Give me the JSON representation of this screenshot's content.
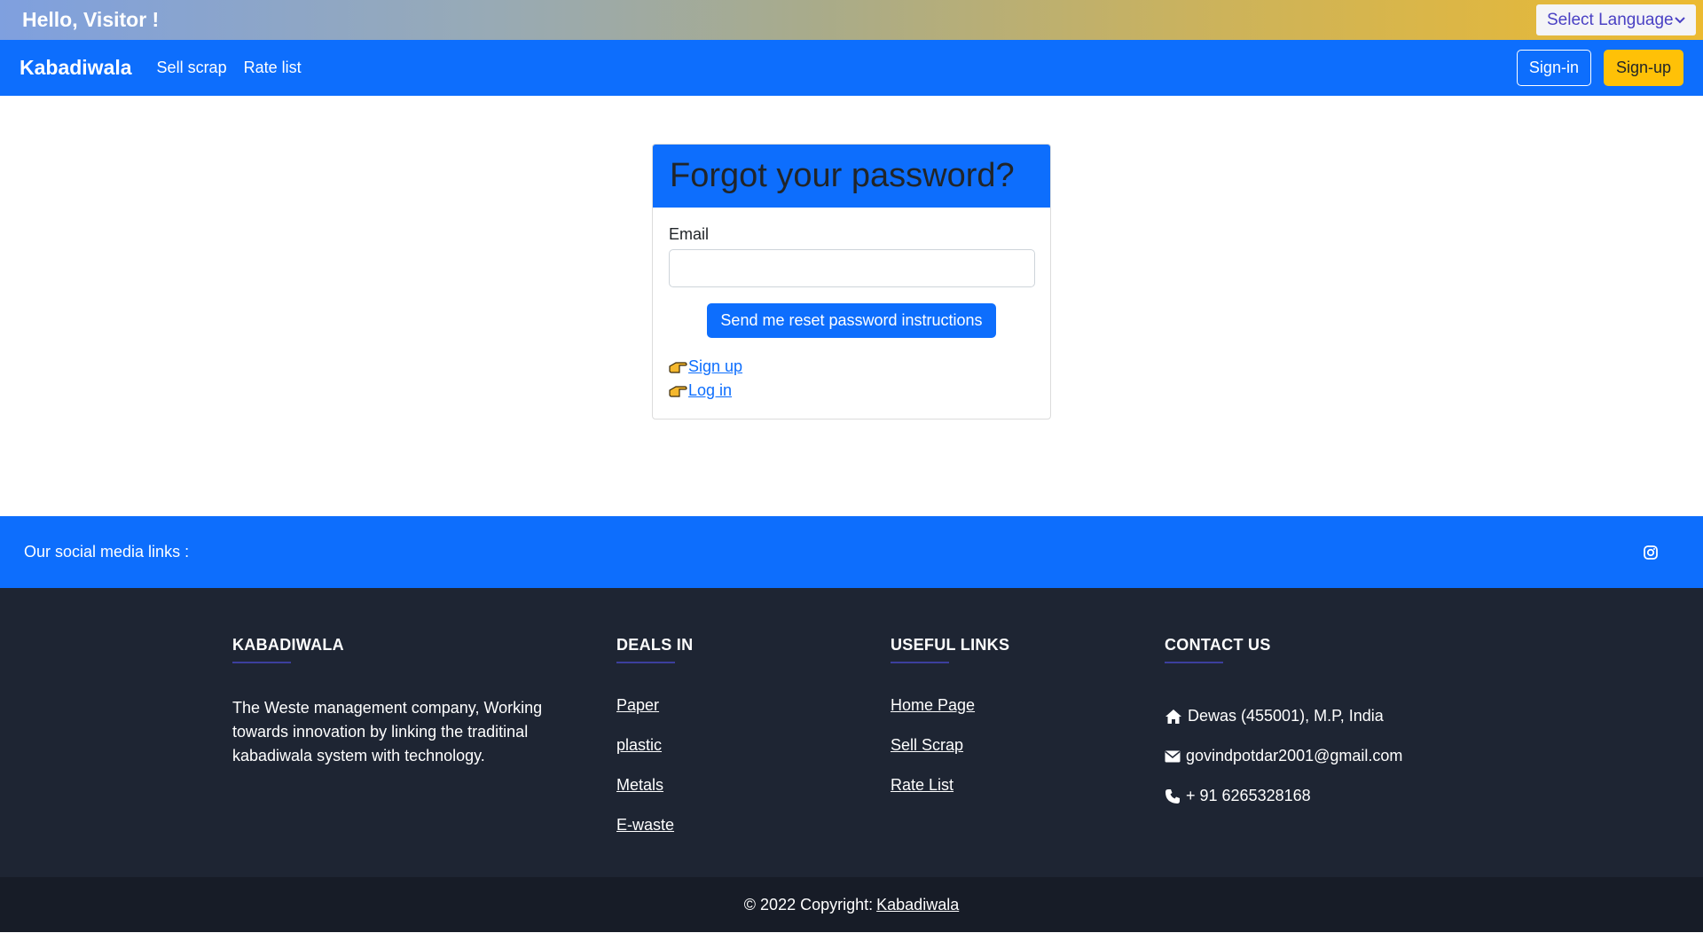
{
  "topbar": {
    "greeting": "Hello, Visitor !",
    "language_select": "Select Language"
  },
  "navbar": {
    "brand": "Kabadiwala",
    "links": [
      "Sell scrap",
      "Rate list"
    ],
    "signin_label": "Sign-in",
    "signup_label": "Sign-up"
  },
  "form": {
    "title": "Forgot your password?",
    "email_label": "Email",
    "email_value": "",
    "submit_label": "Send me reset password instructions",
    "links": [
      "Sign up",
      "Log in"
    ]
  },
  "social": {
    "text": "Our social media links :",
    "icon": "instagram-icon"
  },
  "footer": {
    "about": {
      "heading": "KABADIWALA",
      "text": "The Weste management company, Working towards innovation by linking the traditinal kabadiwala system with technology."
    },
    "deals": {
      "heading": "DEALS IN",
      "items": [
        "Paper",
        "plastic",
        "Metals",
        "E-waste"
      ]
    },
    "useful": {
      "heading": "USEFUL LINKS",
      "items": [
        "Home Page",
        "Sell Scrap",
        "Rate List"
      ]
    },
    "contact": {
      "heading": "CONTACT US",
      "address": "Dewas (455001), M.P, India",
      "email": "govindpotdar2001@gmail.com",
      "phone": "+ 91 6265328168"
    }
  },
  "copyright": {
    "text": "© 2022 Copyright:",
    "link": "Kabadiwala"
  },
  "colors": {
    "primary": "#0d6efd",
    "warning": "#ffc107",
    "footer_bg": "#1e2533",
    "copyright_bg": "#171c27"
  }
}
